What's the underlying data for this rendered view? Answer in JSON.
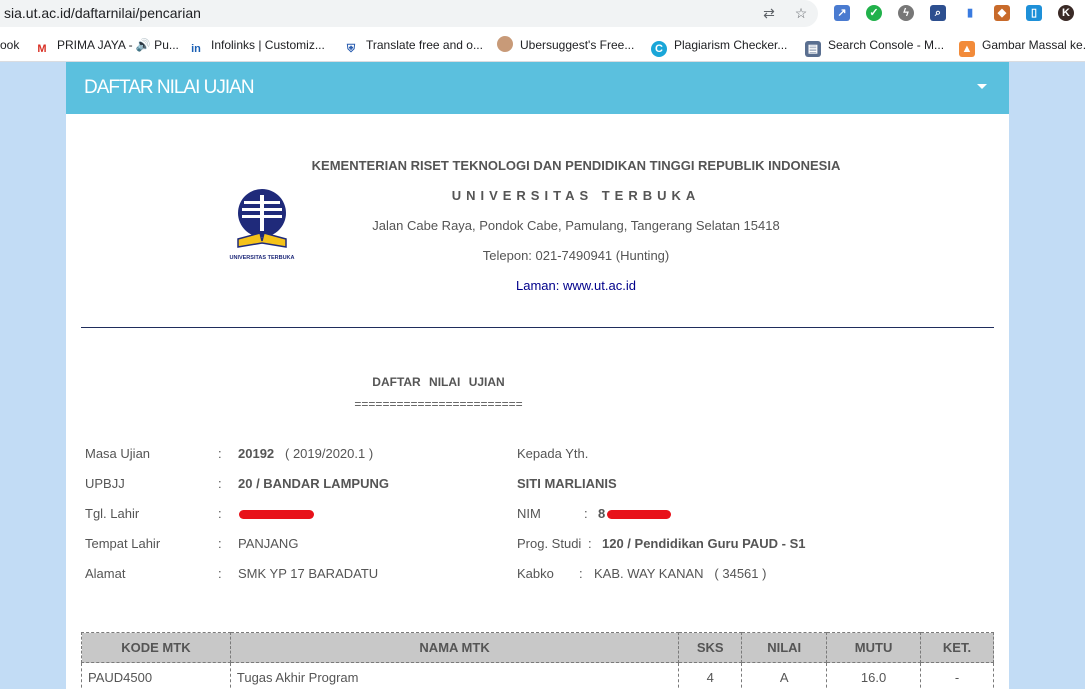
{
  "browser": {
    "url": "sia.ut.ac.id/daftarnilai/pencarian",
    "bookmarks": [
      {
        "label": "ook",
        "icon": "facebook-icon"
      },
      {
        "label": "PRIMA JAYA - 🔊 Pu...",
        "icon": "gmail-icon"
      },
      {
        "label": "Infolinks | Customiz...",
        "icon": "infolinks-icon"
      },
      {
        "label": "Translate free and o...",
        "icon": "shield-icon"
      },
      {
        "label": "Ubersuggest's Free...",
        "icon": "avatar-icon"
      },
      {
        "label": "Plagiarism Checker...",
        "icon": "plagiarism-icon"
      },
      {
        "label": "Search Console - M...",
        "icon": "search-console-icon"
      },
      {
        "label": "Gambar Massal ke...",
        "icon": "image-icon"
      }
    ]
  },
  "panel": {
    "title": "DAFTAR NILAI UJIAN"
  },
  "institution": {
    "ministry": "KEMENTERIAN RISET TEKNOLOGI DAN PENDIDIKAN TINGGI REPUBLIK INDONESIA",
    "university": "UNIVERSITAS TERBUKA",
    "address": "Jalan Cabe Raya, Pondok Cabe, Pamulang, Tangerang Selatan 15418",
    "phone": "Telepon: 021-7490941 (Hunting)",
    "website": "Laman: www.ut.ac.id",
    "logo_caption": "UNIVERSITAS TERBUKA"
  },
  "document": {
    "title": "DAFTAR NILAI UJIAN",
    "rule": "========================"
  },
  "student": {
    "masa_ujian_label": "Masa Ujian",
    "masa_ujian_code": "20192",
    "masa_ujian_period": "( 2019/2020.1 )",
    "upbjj_label": "UPBJJ",
    "upbjj_value": "20 / BANDAR LAMPUNG",
    "tgl_lahir_label": "Tgl. Lahir",
    "tempat_lahir_label": "Tempat Lahir",
    "tempat_lahir_value": "PANJANG",
    "alamat_label": "Alamat",
    "alamat_value": "SMK YP 17 BARADATU",
    "kepada_label": "Kepada Yth.",
    "name": "SITI MARLIANIS",
    "nim_label": "NIM",
    "nim_value": "8",
    "prodi_label": "Prog. Studi",
    "prodi_value": "120 / Pendidikan Guru PAUD - S1",
    "kabko_label": "Kabko",
    "kabko_value": "KAB. WAY KANAN",
    "kabko_code": "( 34561 )",
    "colon": ":"
  },
  "grades": {
    "headers": [
      "KODE MTK",
      "NAMA MTK",
      "SKS",
      "NILAI",
      "MUTU",
      "KET."
    ],
    "rows": [
      [
        "PAUD4500",
        "Tugas Akhir Program",
        "4",
        "A",
        "16.0",
        "-"
      ]
    ]
  },
  "colors": {
    "header_bg": "#5bc0de",
    "page_bg": "#c2dcf5",
    "link": "#00008b",
    "redaction": "#e8121a"
  }
}
